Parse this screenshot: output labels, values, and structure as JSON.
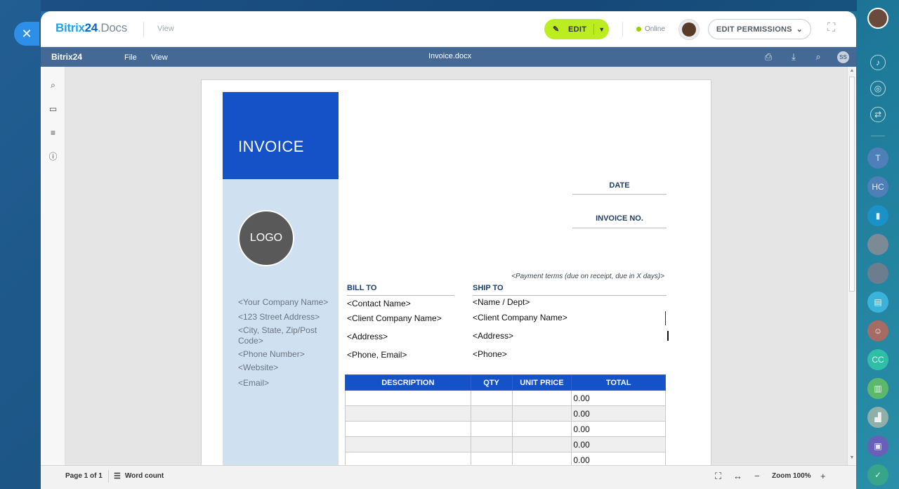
{
  "window": {
    "brand_main": "Bitrix",
    "brand_num": "24",
    "brand_suffix": ".Docs",
    "mode": "View",
    "edit_label": "EDIT",
    "online_label": "Online",
    "permissions_label": "EDIT PERMISSIONS"
  },
  "menubar": {
    "logo": "Bitrix24",
    "items": [
      "File",
      "View"
    ],
    "doc_title": "Invoice.docx",
    "user_initials": "SS"
  },
  "document": {
    "invoice_title": "INVOICE",
    "logo_text": "LOGO",
    "company_lines": [
      "<Your Company Name>",
      "<123 Street Address>",
      "<City, State, Zip/Post Code>",
      "<Phone Number>",
      "<Website>",
      "<Email>"
    ],
    "date_label": "DATE",
    "invoice_no_label": "INVOICE NO.",
    "payment_terms": "<Payment terms (due on receipt, due in X days)>",
    "bill_to": {
      "heading": "BILL TO",
      "lines": [
        "<Contact Name>",
        "<Client Company Name>",
        "<Address>",
        "<Phone, Email>"
      ]
    },
    "ship_to": {
      "heading": "SHIP TO",
      "lines": [
        "<Name / Dept>",
        "<Client Company Name>",
        "<Address>",
        "<Phone>"
      ]
    },
    "table": {
      "headers": [
        "DESCRIPTION",
        "QTY",
        "UNIT PRICE",
        "TOTAL"
      ],
      "totals": [
        "0.00",
        "0.00",
        "0.00",
        "0.00",
        "0.00"
      ]
    }
  },
  "statusbar": {
    "page": "Page 1 of 1",
    "word_count": "Word count",
    "zoom": "Zoom 100%"
  },
  "right_rail": {
    "initials": [
      "T",
      "HC",
      "CC"
    ]
  }
}
